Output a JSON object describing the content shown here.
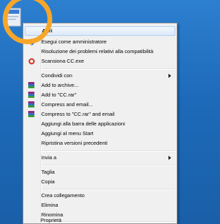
{
  "colors": {
    "desktop": "#1d6ab9",
    "menu_bg": "#f0f0f0",
    "highlight": "#f6a62a"
  },
  "desktop": {
    "icon": "exe-file-icon"
  },
  "menu": {
    "items": [
      {
        "label": "Apri",
        "bold": true,
        "icon": "",
        "submenu": false
      },
      {
        "label": "Esegui come amministratore",
        "bold": false,
        "icon": "uac-shield-icon",
        "submenu": false
      },
      {
        "label": "Risoluzione dei problemi relativi alla compatibilità",
        "bold": false,
        "icon": "",
        "submenu": false
      },
      {
        "label": "Scansiona CC.exe",
        "bold": false,
        "icon": "antivirus-icon",
        "submenu": false
      },
      {
        "label": "Condividi con",
        "bold": false,
        "icon": "",
        "submenu": true
      },
      {
        "label": "Add to archive...",
        "bold": false,
        "icon": "winrar-icon",
        "submenu": false
      },
      {
        "label": "Add to \"CC.rar\"",
        "bold": false,
        "icon": "winrar-icon",
        "submenu": false
      },
      {
        "label": "Compress and email...",
        "bold": false,
        "icon": "winrar-icon",
        "submenu": false
      },
      {
        "label": "Compress to \"CC.rar\" and email",
        "bold": false,
        "icon": "winrar-icon",
        "submenu": false
      },
      {
        "label": "Aggiungi alla barra delle applicazioni",
        "bold": false,
        "icon": "",
        "submenu": false
      },
      {
        "label": "Aggiungi al menu Start",
        "bold": false,
        "icon": "",
        "submenu": false
      },
      {
        "label": "Ripristina versioni precedenti",
        "bold": false,
        "icon": "",
        "submenu": false
      },
      {
        "label": "Invia a",
        "bold": false,
        "icon": "",
        "submenu": true
      },
      {
        "label": "Taglia",
        "bold": false,
        "icon": "",
        "submenu": false
      },
      {
        "label": "Copia",
        "bold": false,
        "icon": "",
        "submenu": false
      },
      {
        "label": "Crea collegamento",
        "bold": false,
        "icon": "",
        "submenu": false
      },
      {
        "label": "Elimina",
        "bold": false,
        "icon": "",
        "submenu": false
      },
      {
        "label": "Rinomina",
        "bold": false,
        "icon": "",
        "submenu": false
      },
      {
        "label": "Proprietà",
        "bold": false,
        "icon": "",
        "submenu": false
      }
    ]
  }
}
